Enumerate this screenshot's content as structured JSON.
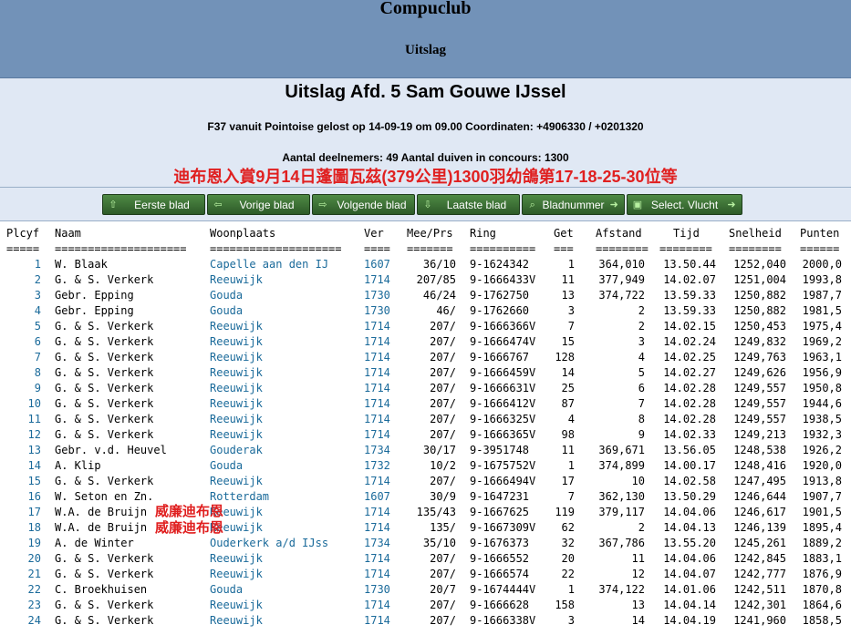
{
  "header": {
    "club": "Compuclub",
    "subtitle": "Uitslag"
  },
  "title": "Uitslag Afd. 5 Sam Gouwe IJssel",
  "info_line1": "F37 vanuit Pointoise gelost op 14-09-19 om 09.00 Coordinaten: +4906330 / +0201320",
  "info_line2": "Aantal deelnemers: 49 Aantal duiven in concours: 1300",
  "banner": "迪布恩入賞9月14日蓬圖瓦茲(379公里)1300羽幼鴿第17-18-25-30位等",
  "nav": [
    {
      "label": "Eerste blad",
      "icon": "arrow-up-icon",
      "glyph": "⇧"
    },
    {
      "label": "Vorige blad",
      "icon": "arrow-left-icon",
      "glyph": "⇦"
    },
    {
      "label": "Volgende blad",
      "icon": "arrow-right-icon",
      "glyph": "⇨"
    },
    {
      "label": "Laatste blad",
      "icon": "arrow-down-icon",
      "glyph": "⇩"
    },
    {
      "label": "Bladnummer",
      "icon": "search-icon",
      "glyph": "⌕",
      "end_glyph": "➜"
    },
    {
      "label": "Select. Vlucht",
      "icon": "select-icon",
      "glyph": "▣",
      "end_glyph": "➜"
    }
  ],
  "table": {
    "columns": [
      "Plcyf",
      "Naam",
      "Woonplaats",
      "Ver",
      "Mee/Prs",
      "Ring",
      "Get",
      "Afstand",
      "Tijd",
      "Snelheid",
      "Punten"
    ],
    "separators": [
      "=====",
      "====================",
      "====================",
      "====",
      "=======",
      "==========",
      "===",
      "========",
      "========",
      "========",
      "======"
    ],
    "rows": [
      [
        "1",
        "W. Blaak",
        "Capelle aan den IJ",
        "1607",
        "36/10",
        "9-1624342",
        "1",
        "364,010",
        "13.50.44",
        "1252,040",
        "2000,0"
      ],
      [
        "2",
        "G. & S. Verkerk",
        "Reeuwijk",
        "1714",
        "207/85",
        "9-1666433V",
        "11",
        "377,949",
        "14.02.07",
        "1251,004",
        "1993,8"
      ],
      [
        "3",
        "Gebr. Epping",
        "Gouda",
        "1730",
        "46/24",
        "9-1762750",
        "13",
        "374,722",
        "13.59.33",
        "1250,882",
        "1987,7"
      ],
      [
        "4",
        "Gebr. Epping",
        "Gouda",
        "1730",
        "46/",
        "9-1762660",
        "3",
        "2",
        "13.59.33",
        "1250,882",
        "1981,5"
      ],
      [
        "5",
        "G. & S. Verkerk",
        "Reeuwijk",
        "1714",
        "207/",
        "9-1666366V",
        "7",
        "2",
        "14.02.15",
        "1250,453",
        "1975,4"
      ],
      [
        "6",
        "G. & S. Verkerk",
        "Reeuwijk",
        "1714",
        "207/",
        "9-1666474V",
        "15",
        "3",
        "14.02.24",
        "1249,832",
        "1969,2"
      ],
      [
        "7",
        "G. & S. Verkerk",
        "Reeuwijk",
        "1714",
        "207/",
        "9-1666767",
        "128",
        "4",
        "14.02.25",
        "1249,763",
        "1963,1"
      ],
      [
        "8",
        "G. & S. Verkerk",
        "Reeuwijk",
        "1714",
        "207/",
        "9-1666459V",
        "14",
        "5",
        "14.02.27",
        "1249,626",
        "1956,9"
      ],
      [
        "9",
        "G. & S. Verkerk",
        "Reeuwijk",
        "1714",
        "207/",
        "9-1666631V",
        "25",
        "6",
        "14.02.28",
        "1249,557",
        "1950,8"
      ],
      [
        "10",
        "G. & S. Verkerk",
        "Reeuwijk",
        "1714",
        "207/",
        "9-1666412V",
        "87",
        "7",
        "14.02.28",
        "1249,557",
        "1944,6"
      ],
      [
        "11",
        "G. & S. Verkerk",
        "Reeuwijk",
        "1714",
        "207/",
        "9-1666325V",
        "4",
        "8",
        "14.02.28",
        "1249,557",
        "1938,5"
      ],
      [
        "12",
        "G. & S. Verkerk",
        "Reeuwijk",
        "1714",
        "207/",
        "9-1666365V",
        "98",
        "9",
        "14.02.33",
        "1249,213",
        "1932,3"
      ],
      [
        "13",
        "Gebr. v.d. Heuvel",
        "Gouderak",
        "1734",
        "30/17",
        "9-3951748",
        "11",
        "369,671",
        "13.56.05",
        "1248,538",
        "1926,2"
      ],
      [
        "14",
        "A. Klip",
        "Gouda",
        "1732",
        "10/2",
        "9-1675752V",
        "1",
        "374,899",
        "14.00.17",
        "1248,416",
        "1920,0"
      ],
      [
        "15",
        "G. & S. Verkerk",
        "Reeuwijk",
        "1714",
        "207/",
        "9-1666494V",
        "17",
        "10",
        "14.02.58",
        "1247,495",
        "1913,8"
      ],
      [
        "16",
        "W. Seton en Zn.",
        "Rotterdam",
        "1607",
        "30/9",
        "9-1647231",
        "7",
        "362,130",
        "13.50.29",
        "1246,644",
        "1907,7"
      ],
      [
        "17",
        "W.A. de Bruijn",
        "Reeuwijk",
        "1714",
        "135/43",
        "9-1667625",
        "119",
        "379,117",
        "14.04.06",
        "1246,617",
        "1901,5"
      ],
      [
        "18",
        "W.A. de Bruijn",
        "Reeuwijk",
        "1714",
        "135/",
        "9-1667309V",
        "62",
        "2",
        "14.04.13",
        "1246,139",
        "1895,4"
      ],
      [
        "19",
        "A. de Winter",
        "Ouderkerk a/d IJss",
        "1734",
        "35/10",
        "9-1676373",
        "32",
        "367,786",
        "13.55.20",
        "1245,261",
        "1889,2"
      ],
      [
        "20",
        "G. & S. Verkerk",
        "Reeuwijk",
        "1714",
        "207/",
        "9-1666552",
        "20",
        "11",
        "14.04.06",
        "1242,845",
        "1883,1"
      ],
      [
        "21",
        "G. & S. Verkerk",
        "Reeuwijk",
        "1714",
        "207/",
        "9-1666574",
        "22",
        "12",
        "14.04.07",
        "1242,777",
        "1876,9"
      ],
      [
        "22",
        "C. Broekhuisen",
        "Gouda",
        "1730",
        "20/7",
        "9-1674444V",
        "1",
        "374,122",
        "14.01.06",
        "1242,511",
        "1870,8"
      ],
      [
        "23",
        "G. & S. Verkerk",
        "Reeuwijk",
        "1714",
        "207/",
        "9-1666628",
        "158",
        "13",
        "14.04.14",
        "1242,301",
        "1864,6"
      ],
      [
        "24",
        "G. & S. Verkerk",
        "Reeuwijk",
        "1714",
        "207/",
        "9-1666338V",
        "3",
        "14",
        "14.04.19",
        "1241,960",
        "1858,5"
      ]
    ]
  },
  "overlays": [
    "威廉迪布恩",
    "威廉迪布恩"
  ]
}
